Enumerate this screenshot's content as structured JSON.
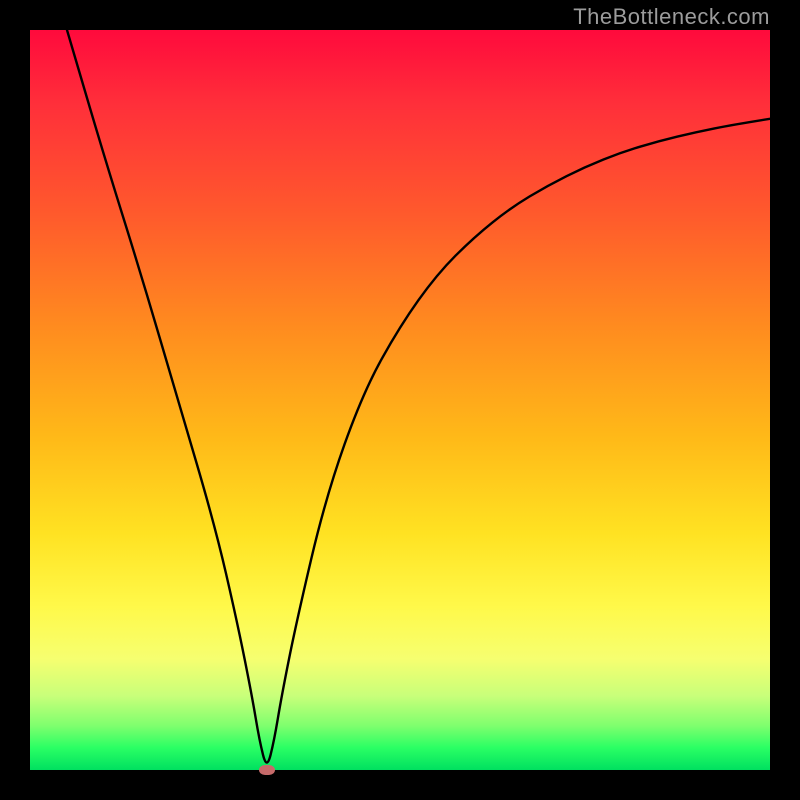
{
  "watermark": "TheBottleneck.com",
  "chart_data": {
    "type": "line",
    "title": "",
    "xlabel": "",
    "ylabel": "",
    "xlim": [
      0,
      100
    ],
    "ylim": [
      0,
      100
    ],
    "grid": false,
    "series": [
      {
        "name": "bottleneck-curve",
        "x": [
          5,
          10,
          15,
          20,
          25,
          28,
          30,
          31,
          32,
          33,
          34,
          36,
          40,
          45,
          50,
          55,
          60,
          65,
          70,
          75,
          80,
          85,
          90,
          95,
          100
        ],
        "y": [
          100,
          83,
          67,
          50,
          33,
          20,
          10,
          4,
          0,
          4,
          10,
          20,
          37,
          51,
          60,
          67,
          72,
          76,
          79,
          81.5,
          83.5,
          85,
          86.2,
          87.2,
          88
        ]
      }
    ],
    "marker": {
      "x": 32,
      "y": 0,
      "name": "minimum-point"
    },
    "gradient_stops": [
      {
        "pos": 0,
        "color": "#ff0a3c"
      },
      {
        "pos": 25,
        "color": "#ff5a2c"
      },
      {
        "pos": 55,
        "color": "#ffb918"
      },
      {
        "pos": 78,
        "color": "#fff94a"
      },
      {
        "pos": 100,
        "color": "#00e060"
      }
    ]
  }
}
